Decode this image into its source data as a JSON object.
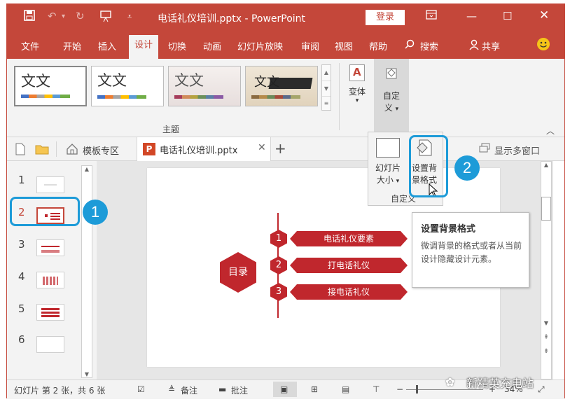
{
  "titlebar": {
    "title": "电话礼仪培训.pptx - PowerPoint",
    "login_label": "登录",
    "qat_icons": [
      "save-icon",
      "undo-icon",
      "redo-icon",
      "present-icon",
      "customize-icon"
    ],
    "window_icons": [
      "ribbon-display-icon",
      "minimize-icon",
      "maximize-icon",
      "close-icon"
    ]
  },
  "menu": {
    "items": [
      "文件",
      "开始",
      "插入",
      "设计",
      "切换",
      "动画",
      "幻灯片放映",
      "审阅",
      "视图",
      "帮助",
      "搜索",
      "共享"
    ],
    "active": "设计"
  },
  "ribbon": {
    "themes": [
      {
        "text": "文文"
      },
      {
        "text": "文文"
      },
      {
        "text": "文文"
      },
      {
        "text": "文文"
      }
    ],
    "themes_group_label": "主题",
    "variants_label": "变体",
    "customize_label_line1": "自定",
    "customize_label_line2": "义"
  },
  "tabs": {
    "template_zone": "模板专区",
    "doc_tab": "电话礼仪培训.pptx",
    "show_multi_window": "显示多窗口"
  },
  "dropdown": {
    "slide_size_line1": "幻灯片",
    "slide_size_line2": "大小",
    "format_bg_line1": "设置背",
    "format_bg_line2": "景格式",
    "group_label": "自定义"
  },
  "tooltip": {
    "title": "设置背景格式",
    "body": "微调背景的格式或者从当前设计隐藏设计元素。"
  },
  "callouts": {
    "badge1": "1",
    "badge2": "2"
  },
  "slides_panel": {
    "numbers": [
      "1",
      "2",
      "3",
      "4",
      "5",
      "6"
    ],
    "selected": "2"
  },
  "slide": {
    "hex_title": "目录",
    "items": [
      {
        "num": "1",
        "label": "电话礼仪要素"
      },
      {
        "num": "2",
        "label": "打电话礼仪"
      },
      {
        "num": "3",
        "label": "接电话礼仪"
      }
    ]
  },
  "statusbar": {
    "slide_info": "幻灯片 第 2 张，共 6 张",
    "notes": "备注",
    "comments": "批注",
    "zoom": "34%"
  },
  "watermark": "新精英充电站",
  "colors": {
    "accent": "#c4473a",
    "slide_red": "#c0272d",
    "callout_blue": "#1d9bd8"
  }
}
